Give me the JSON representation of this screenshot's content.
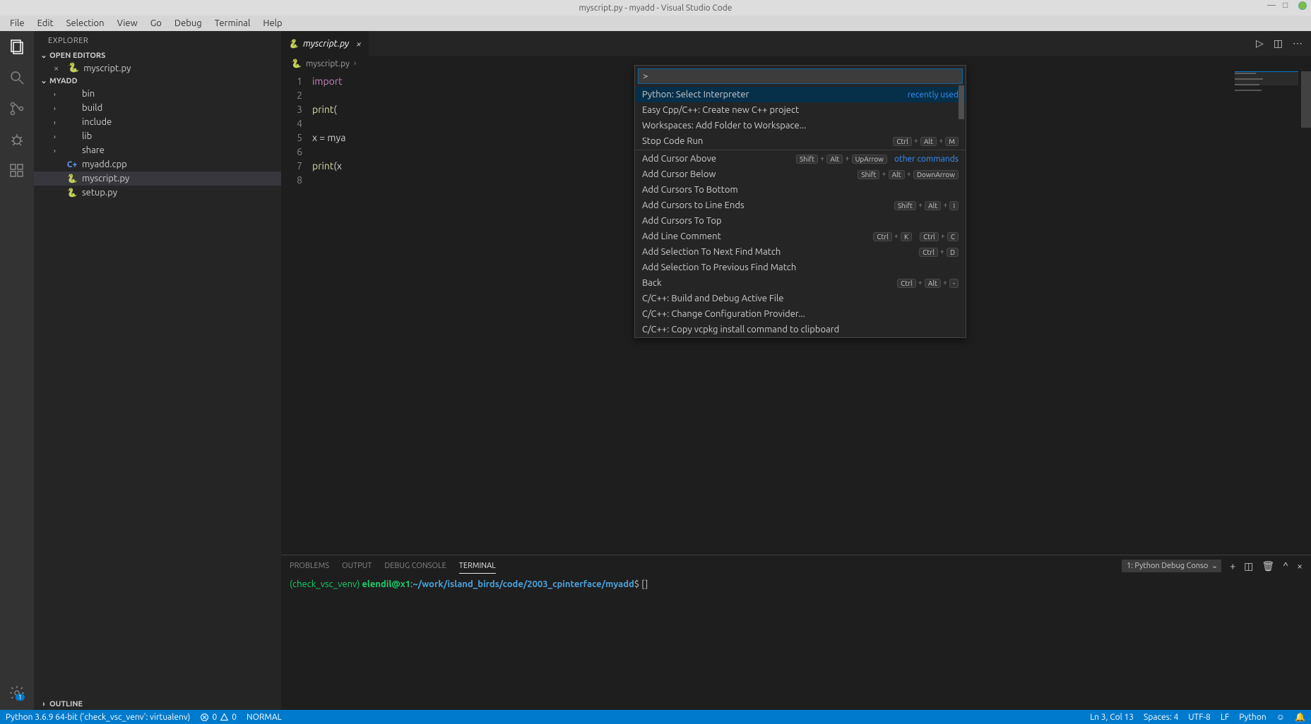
{
  "titlebar": {
    "title": "myscript.py - myadd - Visual Studio Code"
  },
  "menubar": [
    "File",
    "Edit",
    "Selection",
    "View",
    "Go",
    "Debug",
    "Terminal",
    "Help"
  ],
  "sidebar": {
    "title": "EXPLORER",
    "open_editors_label": "OPEN EDITORS",
    "open_editors": [
      {
        "name": "myscript.py"
      }
    ],
    "project": "MYADD",
    "tree": [
      {
        "type": "folder",
        "name": "bin"
      },
      {
        "type": "folder",
        "name": "build"
      },
      {
        "type": "folder",
        "name": "include"
      },
      {
        "type": "folder",
        "name": "lib"
      },
      {
        "type": "folder",
        "name": "share"
      },
      {
        "type": "cpp",
        "name": "myadd.cpp"
      },
      {
        "type": "py",
        "name": "myscript.py",
        "selected": true
      },
      {
        "type": "py",
        "name": "setup.py"
      }
    ],
    "outline_label": "OUTLINE"
  },
  "tabs": {
    "active": "myscript.py"
  },
  "breadcrumb": {
    "file": "myscript.py"
  },
  "code_lines": [
    "import",
    "",
    "print(",
    "",
    "x = mya",
    "",
    "print(x",
    ""
  ],
  "palette": {
    "prefix": ">",
    "items": [
      {
        "label": "Python: Select Interpreter",
        "hint": "recently used",
        "selected": true
      },
      {
        "label": "Easy Cpp/C++: Create new C++ project"
      },
      {
        "label": "Workspaces: Add Folder to Workspace..."
      },
      {
        "label": "Stop Code Run",
        "keys": [
          "Ctrl",
          "Alt",
          "M"
        ]
      },
      {
        "sep": true
      },
      {
        "label": "Add Cursor Above",
        "keys": [
          "Shift",
          "Alt",
          "UpArrow"
        ],
        "hint": "other commands"
      },
      {
        "label": "Add Cursor Below",
        "keys": [
          "Shift",
          "Alt",
          "DownArrow"
        ]
      },
      {
        "label": "Add Cursors To Bottom"
      },
      {
        "label": "Add Cursors to Line Ends",
        "keys": [
          "Shift",
          "Alt",
          "I"
        ]
      },
      {
        "label": "Add Cursors To Top"
      },
      {
        "label": "Add Line Comment",
        "keys": [
          "Ctrl",
          "K"
        ],
        "keys2": [
          "Ctrl",
          "C"
        ]
      },
      {
        "label": "Add Selection To Next Find Match",
        "keys": [
          "Ctrl",
          "D"
        ]
      },
      {
        "label": "Add Selection To Previous Find Match"
      },
      {
        "label": "Back",
        "keys": [
          "Ctrl",
          "Alt",
          "-"
        ]
      },
      {
        "label": "C/C++: Build and Debug Active File"
      },
      {
        "label": "C/C++: Change Configuration Provider..."
      },
      {
        "label": "C/C++: Copy vcpkg install command to clipboard"
      }
    ]
  },
  "panel": {
    "tabs": [
      "PROBLEMS",
      "OUTPUT",
      "DEBUG CONSOLE",
      "TERMINAL"
    ],
    "active_tab": "TERMINAL",
    "terminal_selector": "1: Python Debug Conso",
    "prompt_venv": "(check_vsc_venv) ",
    "prompt_host": "elendil@x1",
    "prompt_colon": ":",
    "prompt_path": "~/work/island_birds/code/2003_cpinterface/myadd",
    "prompt_dollar": "$ ",
    "cursor": "[]"
  },
  "statusbar": {
    "interpreter": "Python 3.6.9 64-bit ('check_vsc_venv': virtualenv)",
    "errors": "0",
    "warnings": "0",
    "mode": "NORMAL",
    "pos": "Ln 3, Col 13",
    "spaces": "Spaces: 4",
    "encoding": "UTF-8",
    "eol": "LF",
    "lang": "Python",
    "feedback": "☺",
    "bell": "🔔"
  }
}
